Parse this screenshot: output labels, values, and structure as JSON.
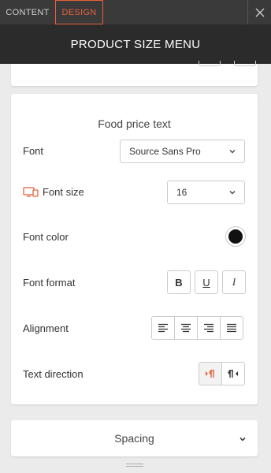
{
  "tabs": {
    "content": "CONTENT",
    "design": "DESIGN",
    "active": "design"
  },
  "header": {
    "title": "PRODUCT SIZE MENU"
  },
  "section": {
    "title": "Food price text",
    "font": {
      "label": "Font",
      "value": "Source Sans Pro"
    },
    "font_size": {
      "label": "Font size",
      "value": "16",
      "icon": "devices-icon"
    },
    "font_color": {
      "label": "Font color",
      "value": "#111111"
    },
    "font_format": {
      "label": "Font format",
      "bold": "B",
      "underline": "U",
      "italic": "I"
    },
    "alignment": {
      "label": "Alignment",
      "options": [
        "left",
        "center",
        "right",
        "justify"
      ]
    },
    "text_direction": {
      "label": "Text direction",
      "options": [
        "ltr",
        "rtl"
      ],
      "selected": "ltr"
    }
  },
  "spacing": {
    "label": "Spacing"
  },
  "colors": {
    "accent": "#e8613a",
    "tab_bar": "#3a3a3a",
    "header": "#2b2b2b"
  }
}
